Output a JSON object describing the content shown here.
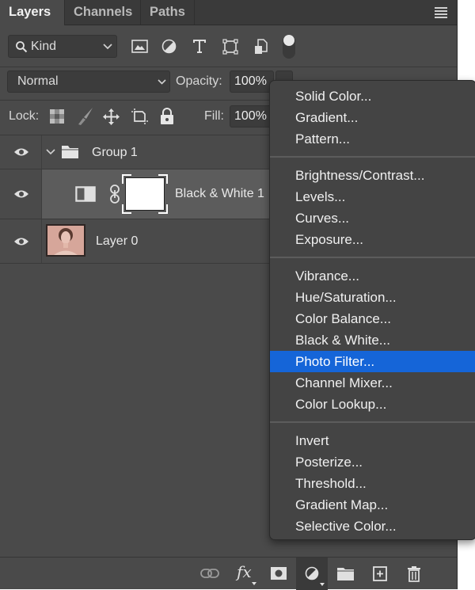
{
  "tabs": [
    {
      "label": "Layers",
      "active": true
    },
    {
      "label": "Channels",
      "active": false
    },
    {
      "label": "Paths",
      "active": false
    }
  ],
  "panel_menu_icon": "hamburger-icon",
  "filter": {
    "kind_label": "Kind",
    "icons": [
      "pixel-layer-filter-icon",
      "adjustment-layer-filter-icon",
      "type-layer-filter-icon",
      "shape-layer-filter-icon",
      "smart-object-filter-icon",
      "filter-toggle-switch"
    ]
  },
  "blend": {
    "mode": "Normal",
    "opacity_label": "Opacity:",
    "opacity_value": "100%"
  },
  "lock": {
    "label": "Lock:",
    "icons": [
      "lock-transparent-pixels-icon",
      "lock-image-pixels-icon",
      "lock-position-icon",
      "lock-artboard-icon",
      "lock-all-icon"
    ],
    "fill_label": "Fill:",
    "fill_value": "100%"
  },
  "layers": [
    {
      "name": "Group 1",
      "type": "group",
      "visible": true,
      "expanded": true
    },
    {
      "name": "Black & White 1",
      "type": "adjustment",
      "visible": true,
      "selected": true
    },
    {
      "name": "Layer 0",
      "type": "pixel",
      "visible": true
    }
  ],
  "footer_icons": [
    "link-layers-icon",
    "fx-icon",
    "add-mask-icon",
    "new-adjustment-layer-icon",
    "new-group-icon",
    "new-layer-icon",
    "trash-icon"
  ],
  "context_menu": {
    "groups": [
      [
        "Solid Color...",
        "Gradient...",
        "Pattern..."
      ],
      [
        "Brightness/Contrast...",
        "Levels...",
        "Curves...",
        "Exposure..."
      ],
      [
        "Vibrance...",
        "Hue/Saturation...",
        "Color Balance...",
        "Black & White...",
        "Photo Filter...",
        "Channel Mixer...",
        "Color Lookup..."
      ],
      [
        "Invert",
        "Posterize...",
        "Threshold...",
        "Gradient Map...",
        "Selective Color..."
      ]
    ],
    "highlighted": "Photo Filter...",
    "highlight_color": "#1565d8"
  }
}
